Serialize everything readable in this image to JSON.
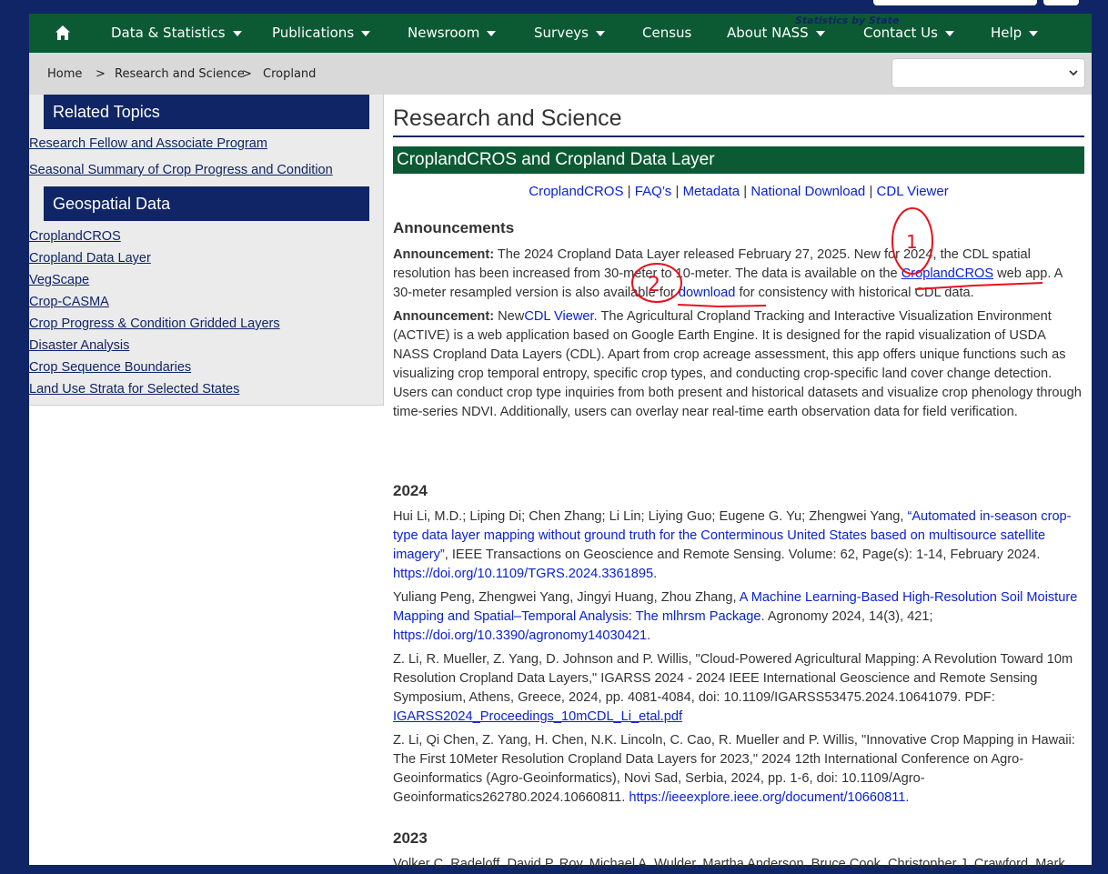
{
  "nav": {
    "items": [
      "Data & Statistics",
      "Publications",
      "Newsroom",
      "Surveys",
      "Census",
      "About NASS",
      "Contact Us",
      "Help"
    ]
  },
  "breadcrumb": {
    "home": "Home",
    "sep": ">",
    "level1": "Research and Science",
    "level2": "Cropland"
  },
  "state": {
    "label": "Statistics by State",
    "value": ""
  },
  "sidebar": {
    "related_title": "Related Topics",
    "related": [
      "Research Fellow and Associate Program",
      "Seasonal Summary of Crop Progress and Condition"
    ],
    "geo_title": "Geospatial Data",
    "geo": [
      "CroplandCROS",
      "Cropland Data Layer",
      "VegScape",
      "Crop-CASMA",
      "Crop Progress & Condition Gridded Layers",
      "Disaster Analysis",
      "Crop Sequence Boundaries",
      "Land Use Strata for Selected States"
    ]
  },
  "main": {
    "page_title": "Research and Science",
    "section_title": "CroplandCROS and Cropland Data Layer",
    "links": [
      "CroplandCROS",
      "FAQ’s",
      "Metadata",
      "National Download",
      "CDL Viewer"
    ],
    "link_sep": "|",
    "announcements_title": "Announcements",
    "ann1": {
      "label": "Announcement:",
      "t1": "The 2024 Cropland Data Layer released February 27, 2025. New for 2024, the CDL spatial resolution has been increased from 30-meter to 10-meter. The data is available on the",
      "link1": "CroplandCROS",
      "t2": "web app. A 30-meter resampled version is also available for",
      "link2": "download",
      "t3": "for consistency with historical CDL data."
    },
    "ann2": {
      "label": "Announcement:",
      "t1": "New",
      "link1": "CDL Viewer",
      "t2": ". The Agricultural Cropland Tracking and Interactive Visualization Environment (ACTIVE) is a web application based on Google Earth Engine. It is designed for the rapid visualization of USDA NASS Cropland Data Layers (CDL). Apart from crop acreage assessment, this app offers unique functions such as visualizing crop temporal entropy, specific crop types, and conducting crop-specific land cover change detection. Users can conduct crop type inquiries from both present and historical datasets and visualize crop phenology through time-series NDVI. Additionally, users can overlay near real-time earth observation data for field verification."
    },
    "year_2024": "2024",
    "pubs": [
      {
        "authors": "Hui Li, M.D.; Liping Di; Chen Zhang; Li Lin; Liying Guo; Eugene G. Yu; Zhengwei Yang,",
        "title": "“Automated in-season crop-type data layer mapping without ground truth for the Conterminous United States based on multisource satellite imagery”",
        "rest": ", IEEE Transactions on Geoscience and Remote Sensing. Volume: 62, Page(s): 1-14, February 2024.",
        "link": "https://doi.org/10.1109/TGRS.2024.3361895",
        "tail": "."
      },
      {
        "authors": "Yuliang Peng, Zhengwei Yang, Jingyi Huang, Zhou Zhang,",
        "title": "A Machine Learning-Based High-Resolution Soil Moisture Mapping and Spatial–Temporal Analysis: The mlhrsm Package",
        "rest": ". Agronomy 2024, 14(3), 421;",
        "link": "https://doi.org/10.3390/agronomy14030421",
        "tail": "."
      },
      {
        "authors": "Z. Li, R. Mueller, Z. Yang, D. Johnson and P. Willis, \"Cloud-Powered Agricultural Mapping: A Revolution Toward 10m Resolution Cropland Data Layers,\" IGARSS 2024 - 2024 IEEE International Geoscience and Remote Sensing Symposium, Athens, Greece, 2024, pp. 4081-4084, doi: 10.1109/IGARSS53475.2024.10641079. PDF:",
        "title": "",
        "rest": "",
        "link": "IGARSS2024_Proceedings_10mCDL_Li_etal.pdf",
        "tail": ""
      },
      {
        "authors": "Z. Li, Qi Chen, Z. Yang, H. Chen, N.K. Lincoln, C. Cao, R. Mueller and P. Willis, \"Innovative Crop Mapping in Hawaii: The First 10Meter Resolution Cropland Data Layers for 2023,\" 2024 12th International Conference on Agro-Geoinformatics (Agro-Geoinformatics), Novi Sad, Serbia, 2024, pp. 1-6, doi: 10.1109/Agro-Geoinformatics262780.2024.10660811.",
        "title": "",
        "rest": "",
        "link": "https://ieeexplore.ieee.org/document/10660811",
        "tail": "."
      }
    ],
    "year_2023": "2023",
    "cut_line": "Volker C. Radeloff, David P. Roy, Michael A. Wulder, Martha Anderson, Bruce Cook, Christopher J. Crawford, Mark"
  },
  "annotations": {
    "mark1": "1",
    "mark2": "2"
  },
  "colors": {
    "navy": "#102565",
    "green": "#0c5a33",
    "link": "#0a22d6",
    "annotation": "#e8101e"
  }
}
